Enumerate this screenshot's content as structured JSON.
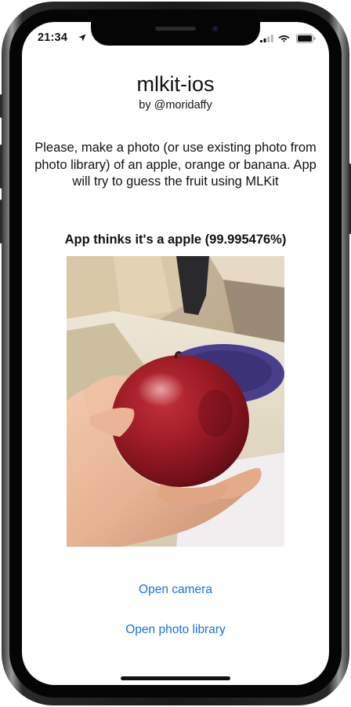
{
  "status_bar": {
    "time": "21:34",
    "icons": [
      "location-arrow-icon",
      "cellular-signal-icon",
      "wifi-icon",
      "battery-icon"
    ]
  },
  "app": {
    "title": "mlkit-ios",
    "subtitle": "by @moridaffy",
    "instructions": "Please, make a photo (or use existing photo from photo library) of an apple, orange or banana. App will try to guess the fruit using MLKit",
    "result": "App thinks it's a apple (99.995476%)"
  },
  "actions": {
    "open_camera_label": "Open camera",
    "open_library_label": "Open photo library"
  },
  "colors": {
    "link": "#1a73d9",
    "text": "#111111",
    "background": "#ffffff"
  }
}
